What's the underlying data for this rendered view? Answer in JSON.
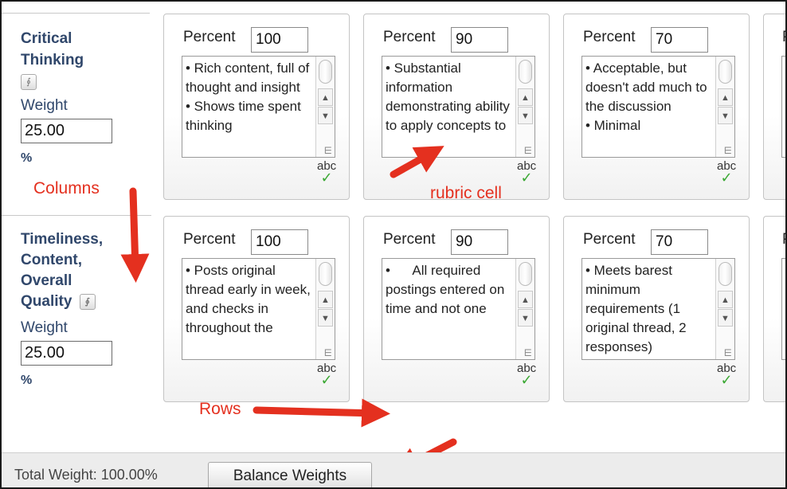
{
  "rows": [
    {
      "title": "Critical Thinking",
      "title_lines": [
        "Critical",
        "Thinking"
      ],
      "weight_label": "Weight",
      "weight_value": "25.00",
      "percent_sign": "%",
      "cells": [
        {
          "percent_label": "Percent",
          "percent_value": "100",
          "description": "• Rich content, full of thought and insight\n• Shows time spent thinking"
        },
        {
          "percent_label": "Percent",
          "percent_value": "90",
          "description": "• Substantial information demonstrating ability to apply concepts to"
        },
        {
          "percent_label": "Percent",
          "percent_value": "70",
          "description": "• Acceptable, but doesn't add much to the discussion\n• Minimal"
        },
        {
          "percent_label": "P"
        }
      ]
    },
    {
      "title": "Timeliness, Content, Overall Quality",
      "title_lines": [
        "Timeliness,",
        "Content,",
        "Overall",
        "Quality"
      ],
      "weight_label": "Weight",
      "weight_value": "25.00",
      "percent_sign": "%",
      "cells": [
        {
          "percent_label": "Percent",
          "percent_value": "100",
          "description": "• Posts original thread early in week, and checks in throughout the"
        },
        {
          "percent_label": "Percent",
          "percent_value": "90",
          "description": "•      All required postings entered on time and not one"
        },
        {
          "percent_label": "Percent",
          "percent_value": "70",
          "description": "• Meets barest minimum requirements (1 original thread, 2 responses)"
        },
        {
          "percent_label": "P"
        }
      ]
    }
  ],
  "icons": {
    "collapse": "double-chevron-down-icon",
    "spellcheck": "spellcheck-icon",
    "scroll_up": "scroll-up-arrow-icon",
    "scroll_down": "scroll-down-arrow-icon",
    "resize": "resize-grip-icon"
  },
  "spellcheck_label": "abc",
  "annotations": {
    "columns": "Columns",
    "rubric_cell": "rubric cell",
    "rows": "Rows"
  },
  "footer": {
    "total_weight": "Total Weight: 100.00%",
    "balance_button": "Balance Weights"
  },
  "colors": {
    "criterion_text": "#30476b",
    "annotation_red": "#e4301f",
    "spellcheck_green": "#3aa832"
  }
}
